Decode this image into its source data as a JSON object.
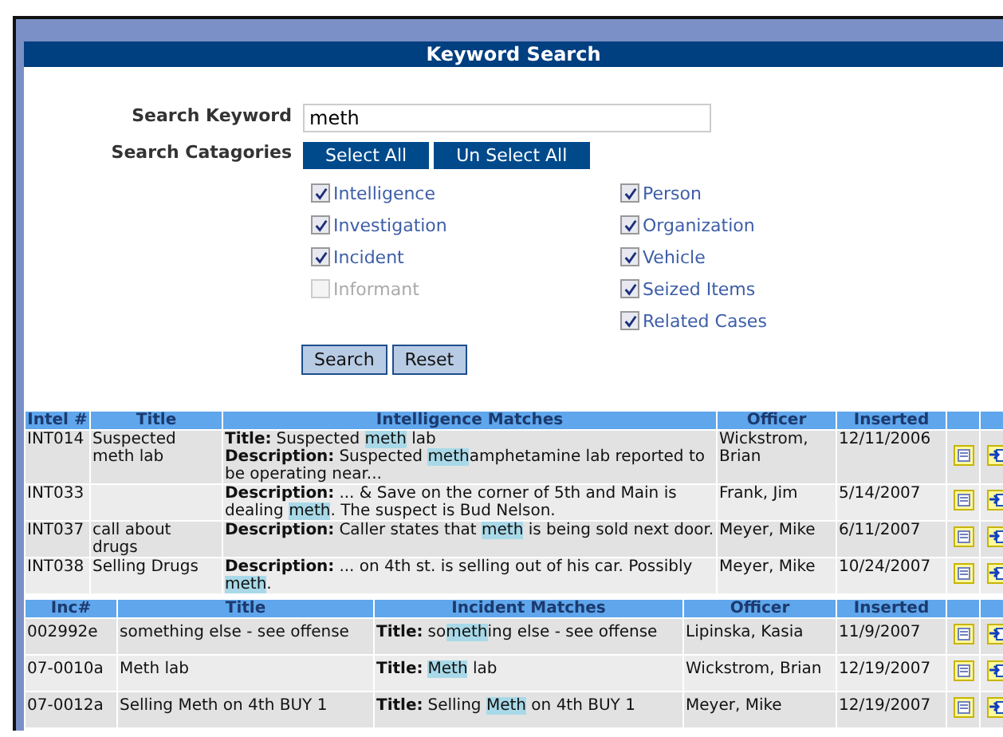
{
  "panel": {
    "title": "Keyword Search"
  },
  "form": {
    "keyword_label": "Search Keyword",
    "keyword_value": "meth",
    "categories_label": "Search Catagories",
    "select_all": "Select All",
    "unselect_all": "Un Select All",
    "categories": [
      [
        {
          "label": "Intelligence",
          "checked": true,
          "disabled": false
        },
        {
          "label": "Investigation",
          "checked": true,
          "disabled": false
        },
        {
          "label": "Incident",
          "checked": true,
          "disabled": false
        },
        {
          "label": "Informant",
          "checked": false,
          "disabled": true
        }
      ],
      [
        {
          "label": "Person",
          "checked": true,
          "disabled": false
        },
        {
          "label": "Organization",
          "checked": true,
          "disabled": false
        },
        {
          "label": "Vehicle",
          "checked": true,
          "disabled": false
        },
        {
          "label": "Seized Items",
          "checked": true,
          "disabled": false
        },
        {
          "label": "Related Cases",
          "checked": true,
          "disabled": false
        }
      ]
    ],
    "search_button": "Search",
    "reset_button": "Reset"
  },
  "tables": [
    {
      "columns": [
        "Intel #",
        "Title",
        "Intelligence Matches",
        "Officer",
        "Inserted"
      ],
      "rows": [
        {
          "id": "INT014",
          "title": "Suspected meth lab",
          "matches": [
            {
              "label": "Title:",
              "parts": [
                {
                  "text": "Suspected ",
                  "hit": false
                },
                {
                  "text": "meth",
                  "hit": true
                },
                {
                  "text": " lab",
                  "hit": false
                }
              ]
            },
            {
              "label": "Description:",
              "parts": [
                {
                  "text": "Suspected ",
                  "hit": false
                },
                {
                  "text": "meth",
                  "hit": true
                },
                {
                  "text": "amphetamine lab reported to be operating near...",
                  "hit": false
                }
              ]
            }
          ],
          "officer": "Wickstrom, Brian",
          "inserted": "12/11/2006"
        },
        {
          "id": "INT033",
          "title": "",
          "matches": [
            {
              "label": "Description:",
              "parts": [
                {
                  "text": "... & Save on the corner of 5th and Main is dealing ",
                  "hit": false
                },
                {
                  "text": "meth",
                  "hit": true
                },
                {
                  "text": ". The suspect is Bud Nelson.",
                  "hit": false
                }
              ]
            }
          ],
          "officer": "Frank, Jim",
          "inserted": "5/14/2007"
        },
        {
          "id": "INT037",
          "title": "call about drugs",
          "matches": [
            {
              "label": "Description:",
              "parts": [
                {
                  "text": "Caller states that ",
                  "hit": false
                },
                {
                  "text": "meth",
                  "hit": true
                },
                {
                  "text": " is being sold next door.",
                  "hit": false
                }
              ]
            }
          ],
          "officer": "Meyer, Mike",
          "inserted": "6/11/2007"
        },
        {
          "id": "INT038",
          "title": "Selling Drugs",
          "matches": [
            {
              "label": "Description:",
              "parts": [
                {
                  "text": "... on 4th st. is selling out of his car. Possibly ",
                  "hit": false
                },
                {
                  "text": "meth",
                  "hit": true
                },
                {
                  "text": ".",
                  "hit": false
                }
              ]
            }
          ],
          "officer": "Meyer, Mike",
          "inserted": "10/24/2007"
        }
      ]
    },
    {
      "columns": [
        "Inc#",
        "Title",
        "Incident Matches",
        "Officer",
        "Inserted"
      ],
      "rows": [
        {
          "id": "002992e",
          "title": "something else - see offense",
          "matches": [
            {
              "label": "Title:",
              "parts": [
                {
                  "text": "so",
                  "hit": false
                },
                {
                  "text": "meth",
                  "hit": true
                },
                {
                  "text": "ing else - see offense",
                  "hit": false
                }
              ]
            }
          ],
          "officer": "Lipinska, Kasia",
          "inserted": "11/9/2007"
        },
        {
          "id": "07-0010a",
          "title": "Meth lab",
          "matches": [
            {
              "label": "Title:",
              "parts": [
                {
                  "text": "Meth",
                  "hit": true
                },
                {
                  "text": " lab",
                  "hit": false
                }
              ]
            }
          ],
          "officer": "Wickstrom, Brian",
          "inserted": "12/19/2007"
        },
        {
          "id": "07-0012a",
          "title": "Selling Meth on 4th BUY 1",
          "matches": [
            {
              "label": "Title:",
              "parts": [
                {
                  "text": "Selling ",
                  "hit": false
                },
                {
                  "text": "Meth",
                  "hit": true
                },
                {
                  "text": " on 4th BUY 1",
                  "hit": false
                }
              ]
            }
          ],
          "officer": "Meyer, Mike",
          "inserted": "12/19/2007"
        }
      ]
    }
  ]
}
